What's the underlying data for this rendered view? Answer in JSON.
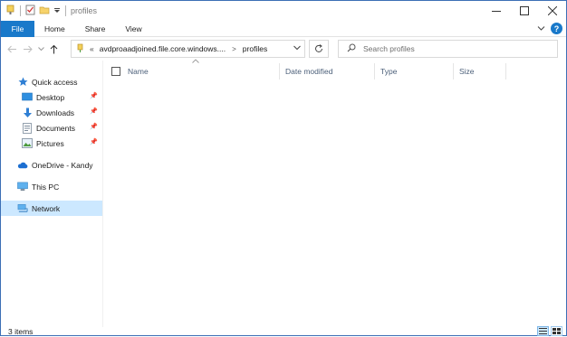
{
  "window": {
    "title": "profiles",
    "controls": [
      "minimize",
      "maximize",
      "close"
    ]
  },
  "ribbon": {
    "tabs": [
      "File",
      "Home",
      "Share",
      "View"
    ]
  },
  "address": {
    "prefix": "«",
    "crumbs": [
      "avdproaadjoined.file.core.windows....",
      "profiles"
    ]
  },
  "search": {
    "placeholder": "Search profiles"
  },
  "nav": {
    "quick_access": "Quick access",
    "items": [
      {
        "label": "Desktop",
        "icon": "desktop-icon",
        "pinned": true
      },
      {
        "label": "Downloads",
        "icon": "download-arrow-icon",
        "pinned": true
      },
      {
        "label": "Documents",
        "icon": "documents-icon",
        "pinned": true
      },
      {
        "label": "Pictures",
        "icon": "pictures-icon",
        "pinned": true
      }
    ],
    "onedrive": "OneDrive - Kandy",
    "this_pc": "This PC",
    "network": "Network"
  },
  "columns": {
    "name": "Name",
    "date_modified": "Date modified",
    "type": "Type",
    "size": "Size"
  },
  "status": {
    "text": "3 items"
  },
  "colors": {
    "accent": "#1979ca",
    "selection": "#cce8ff",
    "header_text": "#4c607a"
  }
}
